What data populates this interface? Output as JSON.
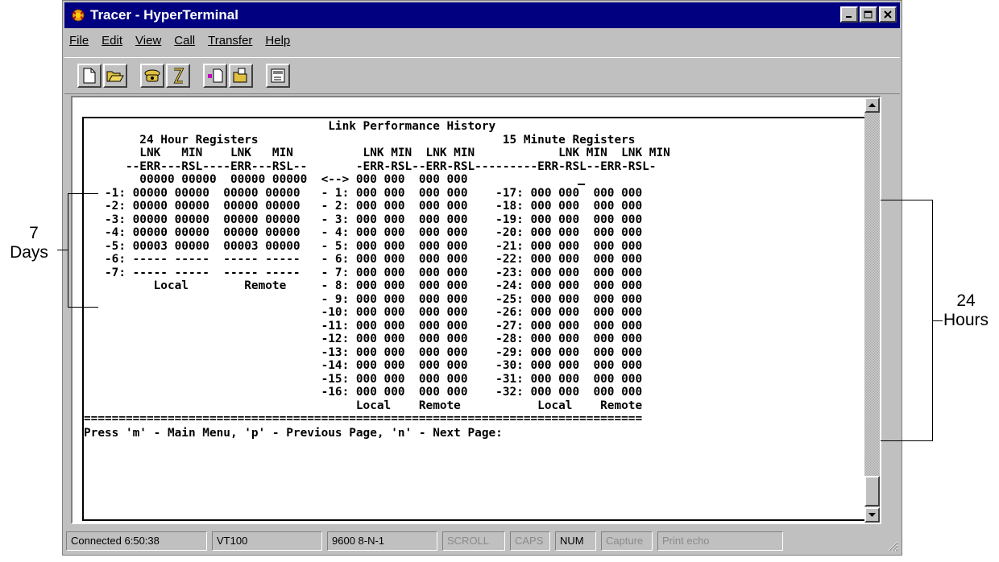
{
  "window": {
    "title": "Tracer - HyperTerminal",
    "title_bar_color": "#000080",
    "controls": [
      "minimize-icon",
      "maximize-icon",
      "close-icon"
    ]
  },
  "menu": {
    "items": [
      "File",
      "Edit",
      "View",
      "Call",
      "Transfer",
      "Help"
    ]
  },
  "toolbar": {
    "buttons": [
      "new-document-icon",
      "open-folder-icon",
      "connect-phone-icon",
      "disconnect-phone-icon",
      "send-file-icon",
      "receive-file-icon",
      "properties-icon"
    ]
  },
  "terminal": {
    "lines": [
      "                                   Link Performance History",
      "        24 Hour Registers                                   15 Minute Registers",
      "        LNK   MIN    LNK   MIN          LNK MIN  LNK MIN            LNK MIN  LNK MIN",
      "      --ERR---RSL----ERR---RSL--       -ERR-RSL--ERR-RSL---------ERR-RSL--ERR-RSL-",
      "        00000 00000  00000 00000  <--> 000 000  000 000",
      "   -1: 00000 00000  00000 00000   - 1: 000 000  000 000    -17: 000 000  000 000",
      "   -2: 00000 00000  00000 00000   - 2: 000 000  000 000    -18: 000 000  000 000",
      "   -3: 00000 00000  00000 00000   - 3: 000 000  000 000    -19: 000 000  000 000",
      "   -4: 00000 00000  00000 00000   - 4: 000 000  000 000    -20: 000 000  000 000",
      "   -5: 00003 00000  00003 00000   - 5: 000 000  000 000    -21: 000 000  000 000",
      "   -6: ----- -----  ----- -----   - 6: 000 000  000 000    -22: 000 000  000 000",
      "   -7: ----- -----  ----- -----   - 7: 000 000  000 000    -23: 000 000  000 000",
      "          Local        Remote     - 8: 000 000  000 000    -24: 000 000  000 000",
      "                                  - 9: 000 000  000 000    -25: 000 000  000 000",
      "                                  -10: 000 000  000 000    -26: 000 000  000 000",
      "                                  -11: 000 000  000 000    -27: 000 000  000 000",
      "                                  -12: 000 000  000 000    -28: 000 000  000 000",
      "                                  -13: 000 000  000 000    -29: 000 000  000 000",
      "                                  -14: 000 000  000 000    -30: 000 000  000 000",
      "                                  -15: 000 000  000 000    -31: 000 000  000 000",
      "                                  -16: 000 000  000 000    -32: 000 000  000 000",
      "                                       Local    Remote           Local    Remote",
      "================================================================================",
      "Press 'm' - Main Menu, 'p' - Previous Page, 'n' - Next Page:"
    ]
  },
  "statusbar": {
    "panels": [
      {
        "label": "Connected 6:50:38",
        "active": true
      },
      {
        "label": "VT100",
        "active": true
      },
      {
        "label": "9600 8-N-1",
        "active": true
      },
      {
        "label": "SCROLL",
        "active": false
      },
      {
        "label": "CAPS",
        "active": false
      },
      {
        "label": "NUM",
        "active": true
      },
      {
        "label": "Capture",
        "active": false
      },
      {
        "label": "Print echo",
        "active": false
      }
    ]
  },
  "annotations": {
    "days": {
      "number": "7",
      "unit": "Days"
    },
    "hours": {
      "number": "24",
      "unit": "Hours"
    }
  }
}
